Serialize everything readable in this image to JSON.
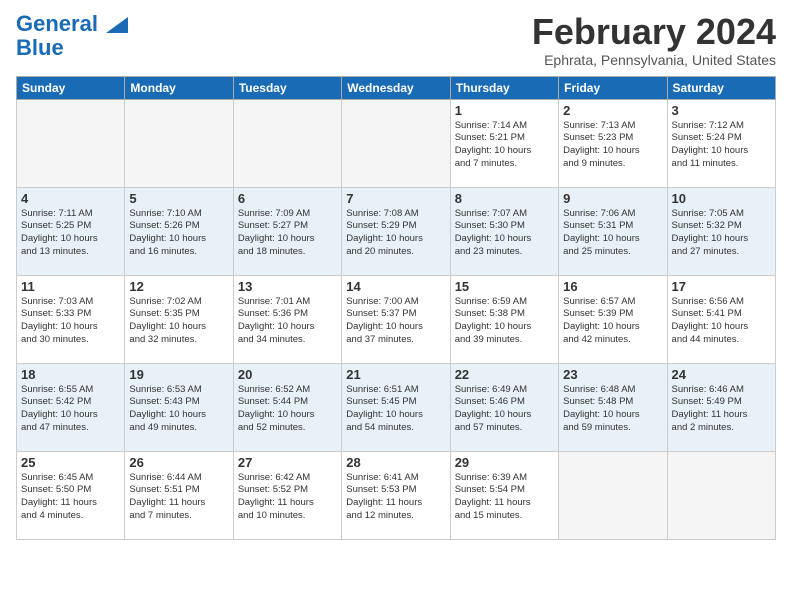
{
  "logo": {
    "line1": "General",
    "line2": "Blue"
  },
  "header": {
    "month": "February 2024",
    "location": "Ephrata, Pennsylvania, United States"
  },
  "weekdays": [
    "Sunday",
    "Monday",
    "Tuesday",
    "Wednesday",
    "Thursday",
    "Friday",
    "Saturday"
  ],
  "weeks": [
    [
      {
        "day": "",
        "info": ""
      },
      {
        "day": "",
        "info": ""
      },
      {
        "day": "",
        "info": ""
      },
      {
        "day": "",
        "info": ""
      },
      {
        "day": "1",
        "info": "Sunrise: 7:14 AM\nSunset: 5:21 PM\nDaylight: 10 hours\nand 7 minutes."
      },
      {
        "day": "2",
        "info": "Sunrise: 7:13 AM\nSunset: 5:23 PM\nDaylight: 10 hours\nand 9 minutes."
      },
      {
        "day": "3",
        "info": "Sunrise: 7:12 AM\nSunset: 5:24 PM\nDaylight: 10 hours\nand 11 minutes."
      }
    ],
    [
      {
        "day": "4",
        "info": "Sunrise: 7:11 AM\nSunset: 5:25 PM\nDaylight: 10 hours\nand 13 minutes."
      },
      {
        "day": "5",
        "info": "Sunrise: 7:10 AM\nSunset: 5:26 PM\nDaylight: 10 hours\nand 16 minutes."
      },
      {
        "day": "6",
        "info": "Sunrise: 7:09 AM\nSunset: 5:27 PM\nDaylight: 10 hours\nand 18 minutes."
      },
      {
        "day": "7",
        "info": "Sunrise: 7:08 AM\nSunset: 5:29 PM\nDaylight: 10 hours\nand 20 minutes."
      },
      {
        "day": "8",
        "info": "Sunrise: 7:07 AM\nSunset: 5:30 PM\nDaylight: 10 hours\nand 23 minutes."
      },
      {
        "day": "9",
        "info": "Sunrise: 7:06 AM\nSunset: 5:31 PM\nDaylight: 10 hours\nand 25 minutes."
      },
      {
        "day": "10",
        "info": "Sunrise: 7:05 AM\nSunset: 5:32 PM\nDaylight: 10 hours\nand 27 minutes."
      }
    ],
    [
      {
        "day": "11",
        "info": "Sunrise: 7:03 AM\nSunset: 5:33 PM\nDaylight: 10 hours\nand 30 minutes."
      },
      {
        "day": "12",
        "info": "Sunrise: 7:02 AM\nSunset: 5:35 PM\nDaylight: 10 hours\nand 32 minutes."
      },
      {
        "day": "13",
        "info": "Sunrise: 7:01 AM\nSunset: 5:36 PM\nDaylight: 10 hours\nand 34 minutes."
      },
      {
        "day": "14",
        "info": "Sunrise: 7:00 AM\nSunset: 5:37 PM\nDaylight: 10 hours\nand 37 minutes."
      },
      {
        "day": "15",
        "info": "Sunrise: 6:59 AM\nSunset: 5:38 PM\nDaylight: 10 hours\nand 39 minutes."
      },
      {
        "day": "16",
        "info": "Sunrise: 6:57 AM\nSunset: 5:39 PM\nDaylight: 10 hours\nand 42 minutes."
      },
      {
        "day": "17",
        "info": "Sunrise: 6:56 AM\nSunset: 5:41 PM\nDaylight: 10 hours\nand 44 minutes."
      }
    ],
    [
      {
        "day": "18",
        "info": "Sunrise: 6:55 AM\nSunset: 5:42 PM\nDaylight: 10 hours\nand 47 minutes."
      },
      {
        "day": "19",
        "info": "Sunrise: 6:53 AM\nSunset: 5:43 PM\nDaylight: 10 hours\nand 49 minutes."
      },
      {
        "day": "20",
        "info": "Sunrise: 6:52 AM\nSunset: 5:44 PM\nDaylight: 10 hours\nand 52 minutes."
      },
      {
        "day": "21",
        "info": "Sunrise: 6:51 AM\nSunset: 5:45 PM\nDaylight: 10 hours\nand 54 minutes."
      },
      {
        "day": "22",
        "info": "Sunrise: 6:49 AM\nSunset: 5:46 PM\nDaylight: 10 hours\nand 57 minutes."
      },
      {
        "day": "23",
        "info": "Sunrise: 6:48 AM\nSunset: 5:48 PM\nDaylight: 10 hours\nand 59 minutes."
      },
      {
        "day": "24",
        "info": "Sunrise: 6:46 AM\nSunset: 5:49 PM\nDaylight: 11 hours\nand 2 minutes."
      }
    ],
    [
      {
        "day": "25",
        "info": "Sunrise: 6:45 AM\nSunset: 5:50 PM\nDaylight: 11 hours\nand 4 minutes."
      },
      {
        "day": "26",
        "info": "Sunrise: 6:44 AM\nSunset: 5:51 PM\nDaylight: 11 hours\nand 7 minutes."
      },
      {
        "day": "27",
        "info": "Sunrise: 6:42 AM\nSunset: 5:52 PM\nDaylight: 11 hours\nand 10 minutes."
      },
      {
        "day": "28",
        "info": "Sunrise: 6:41 AM\nSunset: 5:53 PM\nDaylight: 11 hours\nand 12 minutes."
      },
      {
        "day": "29",
        "info": "Sunrise: 6:39 AM\nSunset: 5:54 PM\nDaylight: 11 hours\nand 15 minutes."
      },
      {
        "day": "",
        "info": ""
      },
      {
        "day": "",
        "info": ""
      }
    ]
  ]
}
